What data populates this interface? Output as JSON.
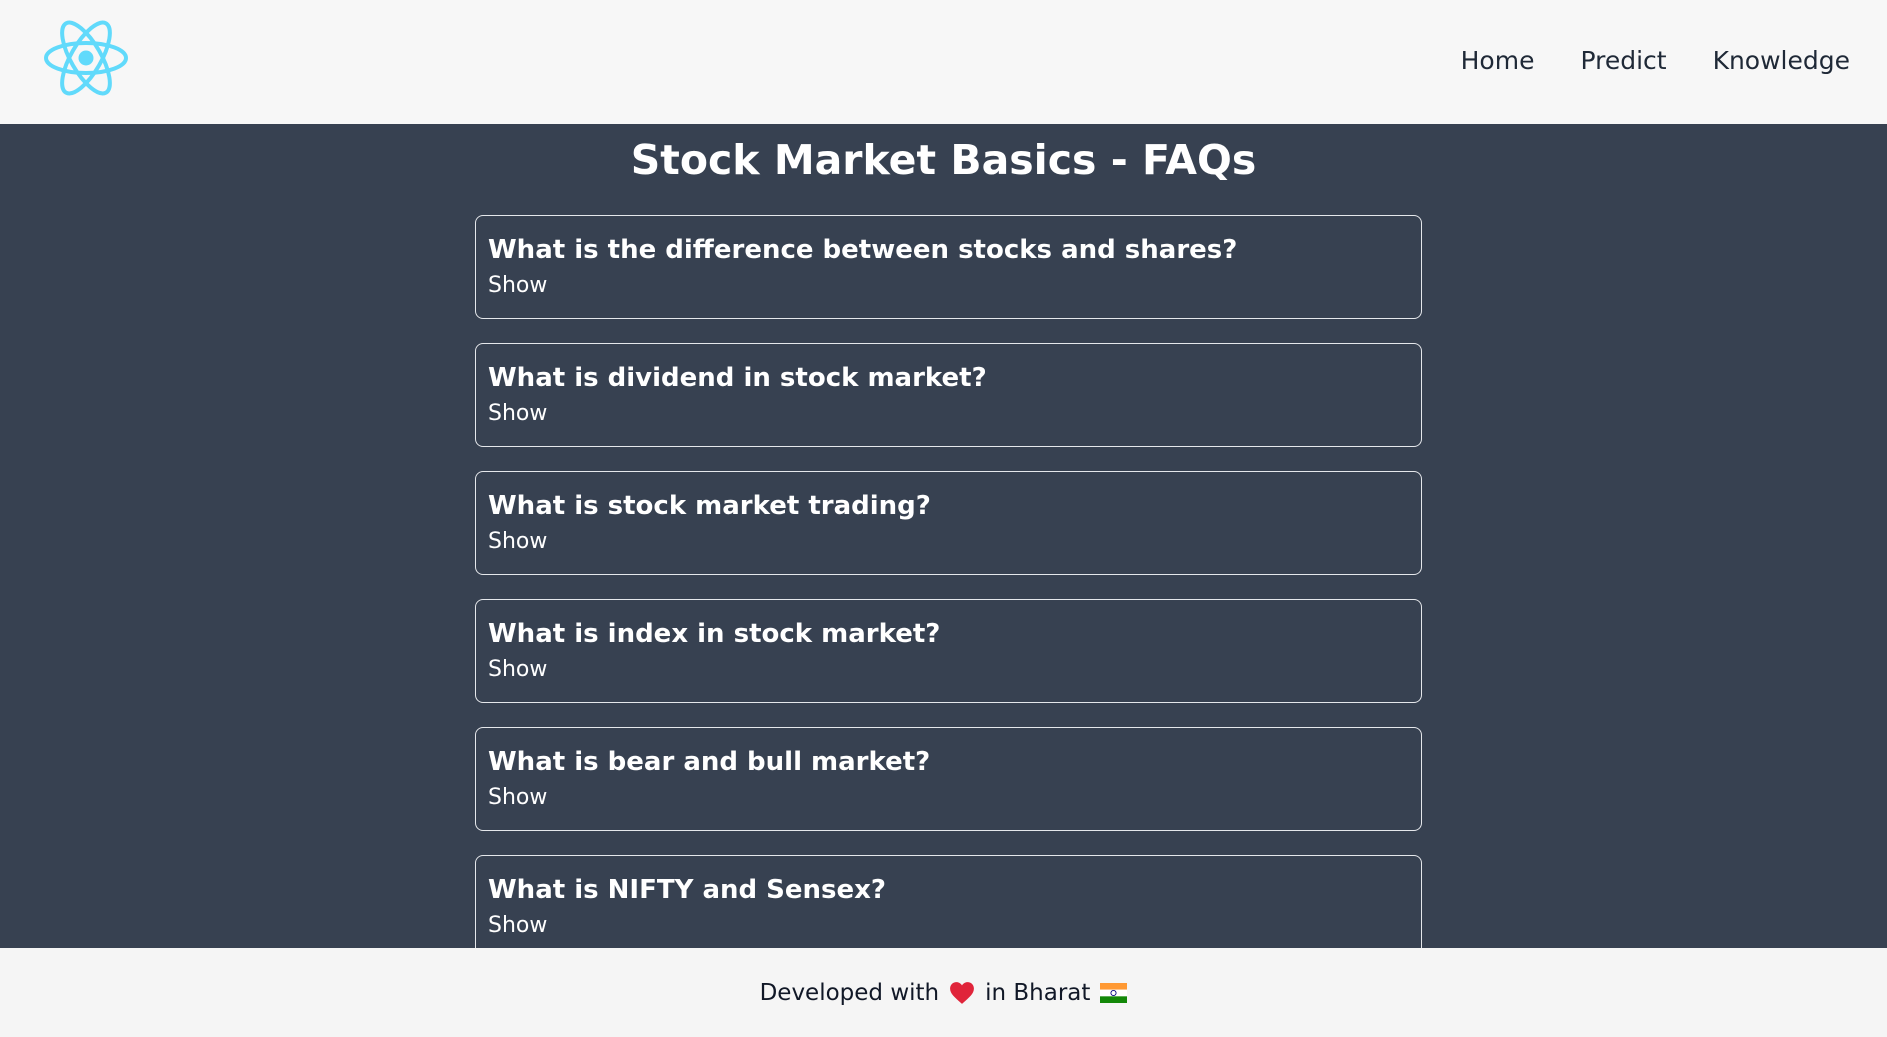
{
  "navbar": {
    "logo_icon": "react-atom-icon",
    "links": [
      {
        "label": "Home"
      },
      {
        "label": "Predict"
      },
      {
        "label": "Knowledge"
      }
    ]
  },
  "main": {
    "title": "Stock Market Basics - FAQs",
    "faqs": [
      {
        "question": "What is the difference between stocks and shares?",
        "toggle": "Show"
      },
      {
        "question": "What is dividend in stock market?",
        "toggle": "Show"
      },
      {
        "question": "What is stock market trading?",
        "toggle": "Show"
      },
      {
        "question": "What is index in stock market?",
        "toggle": "Show"
      },
      {
        "question": "What is bear and bull market?",
        "toggle": "Show"
      },
      {
        "question": "What is NIFTY and Sensex?",
        "toggle": "Show"
      }
    ]
  },
  "footer": {
    "text_before": "Developed with",
    "heart_icon": "heart-icon",
    "text_after": "in Bharat",
    "flag_icon": "india-flag-icon"
  },
  "colors": {
    "navbar_bg": "#f7f7f7",
    "main_bg": "#374151",
    "accent_react": "#61dafb",
    "heart": "#e0243a"
  }
}
